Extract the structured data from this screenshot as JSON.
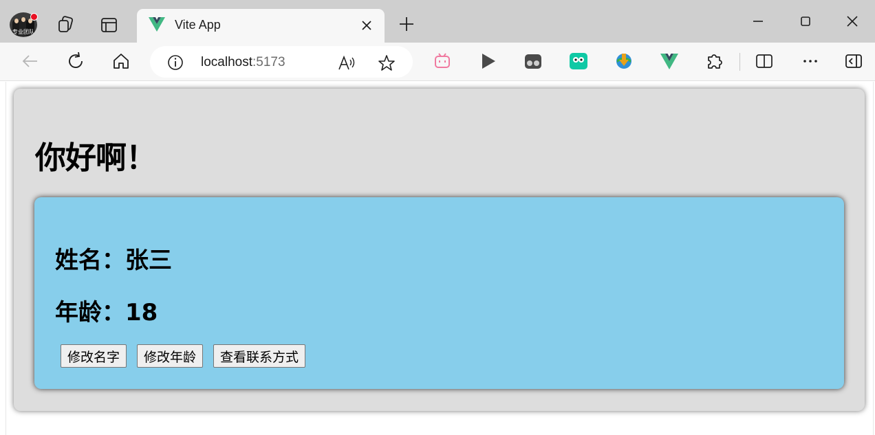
{
  "browser": {
    "profile_caption": "专业团队",
    "tab": {
      "title": "Vite App"
    },
    "address": {
      "host": "localhost",
      "port": ":5173"
    }
  },
  "page": {
    "heading": "你好啊！",
    "person": {
      "name_label": "姓名：",
      "name": "张三",
      "age_label": "年龄：",
      "age": "18"
    },
    "buttons": {
      "change_name": "修改名字",
      "change_age": "修改年龄",
      "view_contact": "查看联系方式"
    }
  },
  "colors": {
    "outer_card": "#dddddd",
    "inner_card": "#87ceeb",
    "vue_green": "#41b883",
    "vue_dark": "#35495e"
  }
}
